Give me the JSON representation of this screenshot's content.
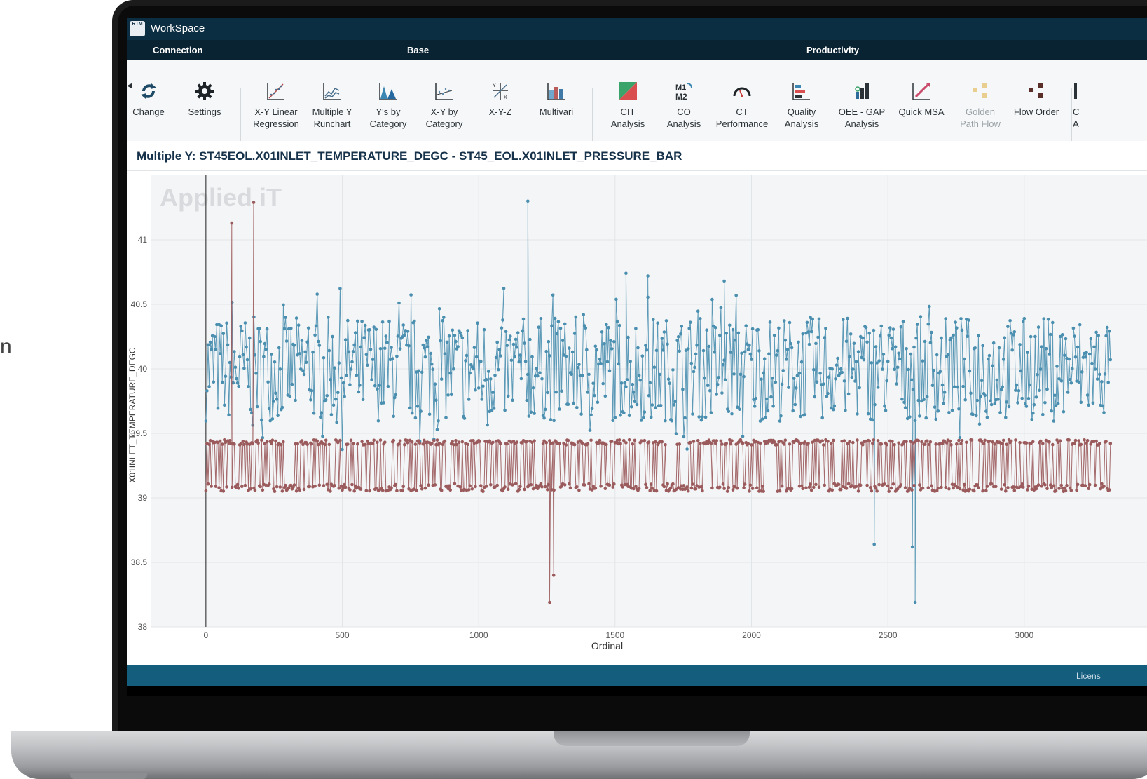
{
  "background_text": "n",
  "app": {
    "title": "WorkSpace",
    "logo_text": "RTM"
  },
  "ribbon": {
    "groups": [
      "Connection",
      "Base",
      "Productivity"
    ],
    "tools": [
      {
        "label1": "Change",
        "label2": "",
        "icon": "refresh-icon",
        "disabled": false
      },
      {
        "label1": "Settings",
        "label2": "",
        "icon": "gear-icon",
        "disabled": false
      },
      {
        "label1": "X-Y Linear",
        "label2": "Regression",
        "icon": "linear-regression-icon",
        "disabled": false
      },
      {
        "label1": "Multiple Y",
        "label2": "Runchart",
        "icon": "runchart-icon",
        "disabled": false
      },
      {
        "label1": "Y's by",
        "label2": "Category",
        "icon": "ys-by-category-icon",
        "disabled": false
      },
      {
        "label1": "X-Y by",
        "label2": "Category",
        "icon": "xy-by-category-icon",
        "disabled": false
      },
      {
        "label1": "X-Y-Z",
        "label2": "",
        "icon": "xyz-icon",
        "disabled": false
      },
      {
        "label1": "Multivari",
        "label2": "",
        "icon": "multivari-icon",
        "disabled": false
      },
      {
        "label1": "CIT",
        "label2": "Analysis",
        "icon": "cit-analysis-icon",
        "disabled": false
      },
      {
        "label1": "CO",
        "label2": "Analysis",
        "icon": "co-analysis-icon",
        "disabled": false
      },
      {
        "label1": "CT",
        "label2": "Performance",
        "icon": "gauge-icon",
        "disabled": false
      },
      {
        "label1": "Quality",
        "label2": "Analysis",
        "icon": "quality-analysis-icon",
        "disabled": false
      },
      {
        "label1": "OEE - GAP",
        "label2": "Analysis",
        "icon": "oee-gap-icon",
        "disabled": false
      },
      {
        "label1": "Quick MSA",
        "label2": "",
        "icon": "quick-msa-icon",
        "disabled": false
      },
      {
        "label1": "Golden",
        "label2": "Path Flow",
        "icon": "golden-path-icon",
        "disabled": true
      },
      {
        "label1": "Flow Order",
        "label2": "",
        "icon": "flow-order-icon",
        "disabled": false
      },
      {
        "label1": "C",
        "label2": "A",
        "icon": "partial-tool-icon",
        "disabled": false
      }
    ]
  },
  "chart_title": "Multiple Y: ST45EOL.X01INLET_TEMPERATURE_DEGC - ST45_EOL.X01INLET_PRESSURE_BAR",
  "watermark": "Applied iT",
  "status": {
    "text": "Licens"
  },
  "chart_data": {
    "type": "line",
    "title": "Multiple Y: ST45EOL.X01INLET_TEMPERATURE_DEGC - ST45_EOL.X01INLET_PRESSURE_BAR",
    "xlabel": "Ordinal",
    "ylabel": "X01INLET_TEMPERATURE_DEGC",
    "xlim": [
      -200,
      3450
    ],
    "ylim": [
      38,
      41.5
    ],
    "x_ticks": [
      0,
      500,
      1000,
      1500,
      2000,
      2500,
      3000
    ],
    "y_ticks": [
      38,
      38.5,
      39,
      39.5,
      40,
      40.5,
      41
    ],
    "grid": true,
    "n_points": 3320,
    "series": [
      {
        "name": "ST45EOL.X01INLET_TEMPERATURE_DEGC",
        "color": "#4a8fb0",
        "typical_range": [
          39.55,
          40.45
        ],
        "notable_points": [
          {
            "x": 1180,
            "y": 41.3
          },
          {
            "x": 1540,
            "y": 40.74
          },
          {
            "x": 1620,
            "y": 40.72
          },
          {
            "x": 1900,
            "y": 40.68
          },
          {
            "x": 2600,
            "y": 38.19
          },
          {
            "x": 2450,
            "y": 38.64
          },
          {
            "x": 2590,
            "y": 38.62
          }
        ]
      },
      {
        "name": "ST45_EOL.X01INLET_PRESSURE_BAR",
        "color": "#9b5b5d",
        "typical_range": [
          39.05,
          39.45
        ],
        "notable_points": [
          {
            "x": 95,
            "y": 41.13
          },
          {
            "x": 175,
            "y": 41.29
          },
          {
            "x": 1260,
            "y": 38.19
          },
          {
            "x": 1275,
            "y": 38.4
          }
        ]
      }
    ]
  }
}
